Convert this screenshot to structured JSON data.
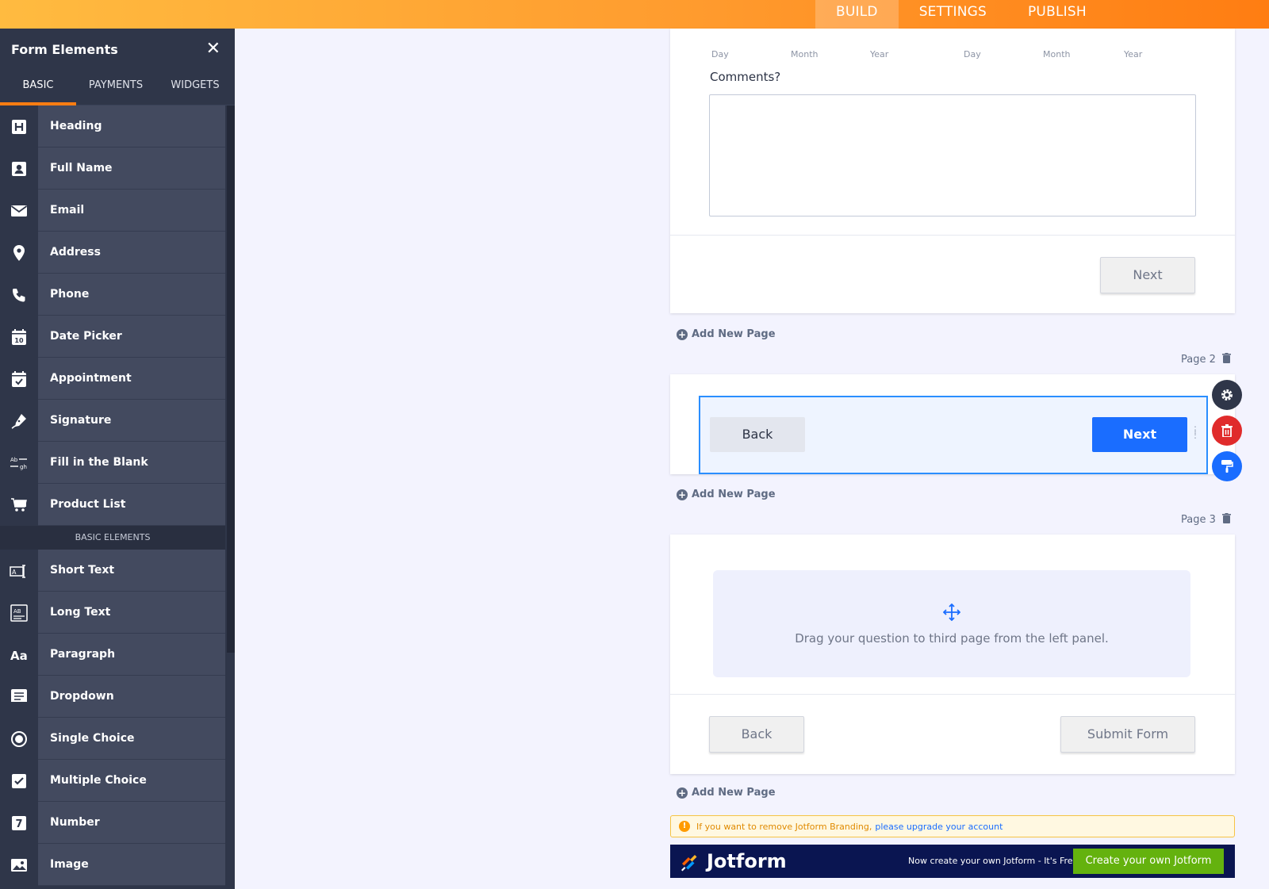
{
  "topnav": {
    "tabs": [
      {
        "label": "BUILD",
        "active": true
      },
      {
        "label": "SETTINGS",
        "active": false
      },
      {
        "label": "PUBLISH",
        "active": false
      }
    ]
  },
  "sidebar": {
    "title": "Form Elements",
    "tabs": [
      {
        "label": "BASIC",
        "active": true
      },
      {
        "label": "PAYMENTS",
        "active": false
      },
      {
        "label": "WIDGETS",
        "active": false
      }
    ],
    "items": [
      {
        "label": "Heading",
        "icon": "heading-icon"
      },
      {
        "label": "Full Name",
        "icon": "person-icon"
      },
      {
        "label": "Email",
        "icon": "envelope-icon"
      },
      {
        "label": "Address",
        "icon": "location-pin-icon"
      },
      {
        "label": "Phone",
        "icon": "phone-icon"
      },
      {
        "label": "Date Picker",
        "icon": "calendar-icon"
      },
      {
        "label": "Appointment",
        "icon": "calendar-check-icon"
      },
      {
        "label": "Signature",
        "icon": "pen-icon"
      },
      {
        "label": "Fill in the Blank",
        "icon": "fill-blank-icon"
      },
      {
        "label": "Product List",
        "icon": "cart-icon"
      }
    ],
    "section_label": "BASIC ELEMENTS",
    "basic_items": [
      {
        "label": "Short Text",
        "icon": "short-text-icon"
      },
      {
        "label": "Long Text",
        "icon": "long-text-icon"
      },
      {
        "label": "Paragraph",
        "icon": "paragraph-icon"
      },
      {
        "label": "Dropdown",
        "icon": "dropdown-icon"
      },
      {
        "label": "Single Choice",
        "icon": "radio-icon"
      },
      {
        "label": "Multiple Choice",
        "icon": "checkbox-icon"
      },
      {
        "label": "Number",
        "icon": "number-icon"
      },
      {
        "label": "Image",
        "icon": "image-icon"
      }
    ]
  },
  "page1": {
    "date_sublabels": [
      "Day",
      "Month",
      "Year",
      "Day",
      "Month",
      "Year"
    ],
    "comments_label": "Comments?",
    "next_label": "Next"
  },
  "add_page_label": "Add New Page",
  "page2": {
    "page_label": "Page 2",
    "back_label": "Back",
    "next_label": "Next"
  },
  "page3": {
    "page_label": "Page 3",
    "drop_text": "Drag your question to third page from the left panel.",
    "back_label": "Back",
    "submit_label": "Submit Form"
  },
  "notice": {
    "text": "If you want to remove Jotform Branding,",
    "link": "please upgrade your account"
  },
  "branding": {
    "name": "Jotform",
    "tagline": "Now create your own Jotform - It's Free",
    "cta": "Create your own Jotform"
  },
  "colors": {
    "accent": "#ff7d12",
    "primary_button": "#1a6dff",
    "delete": "#e02b2b",
    "sidebar": "#2f3649"
  }
}
